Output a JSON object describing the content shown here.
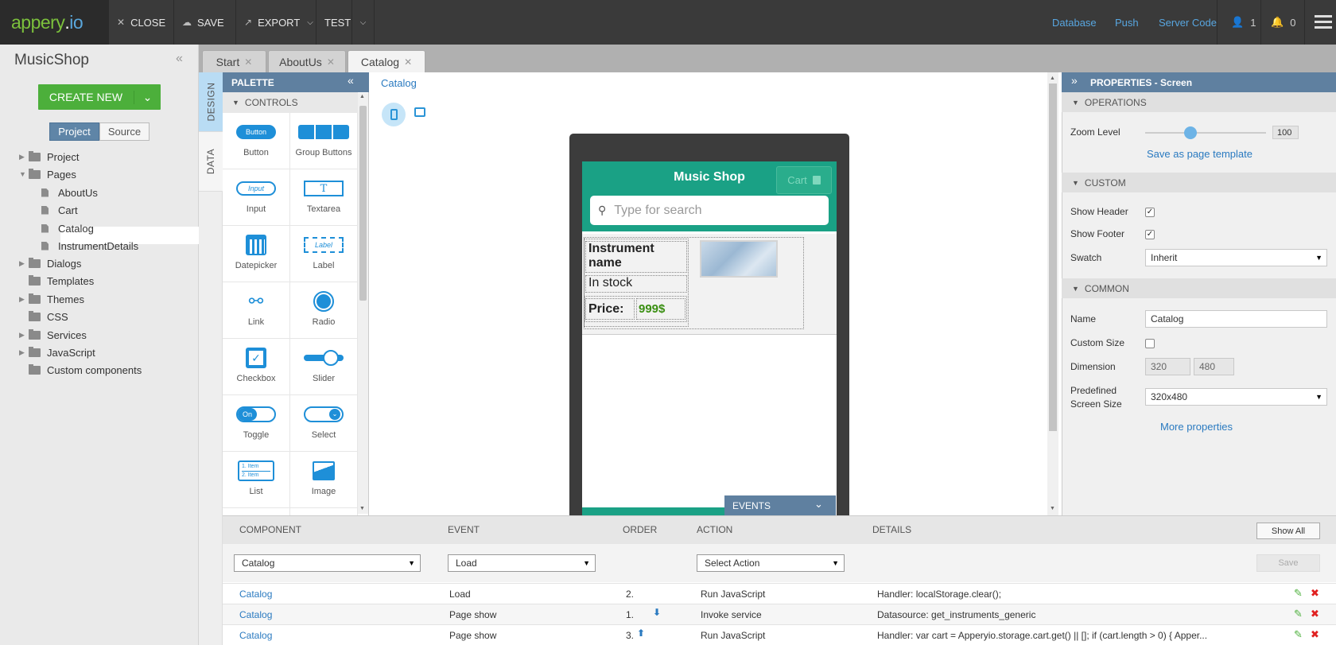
{
  "app": {
    "logo_part1": "appery",
    "logo_part2": ".",
    "logo_part3": "io",
    "toolbar": {
      "close": "CLOSE",
      "save": "SAVE",
      "export": "EXPORT",
      "test": "TEST"
    },
    "nav_links": [
      "Database",
      "Push",
      "Server Code"
    ],
    "user_count": "1",
    "notif_count": "0"
  },
  "project": {
    "name": "MusicShop",
    "create_new": "CREATE NEW",
    "tabs": {
      "project": "Project",
      "source": "Source"
    },
    "tree": [
      {
        "label": "Project",
        "kind": "folder"
      },
      {
        "label": "Pages",
        "kind": "folder"
      },
      {
        "label": "AboutUs",
        "kind": "page"
      },
      {
        "label": "Cart",
        "kind": "page"
      },
      {
        "label": "Catalog",
        "kind": "page"
      },
      {
        "label": "InstrumentDetails",
        "kind": "page"
      },
      {
        "label": "Dialogs",
        "kind": "folder"
      },
      {
        "label": "Templates",
        "kind": "folder"
      },
      {
        "label": "Themes",
        "kind": "folder"
      },
      {
        "label": "CSS",
        "kind": "folder"
      },
      {
        "label": "Services",
        "kind": "folder"
      },
      {
        "label": "JavaScript",
        "kind": "folder"
      },
      {
        "label": "Custom components",
        "kind": "folder"
      }
    ]
  },
  "page_tabs": [
    "Start",
    "AboutUs",
    "Catalog"
  ],
  "vtabs": {
    "design": "DESIGN",
    "data": "DATA"
  },
  "palette": {
    "title": "PALETTE",
    "section": "CONTROLS",
    "items": [
      "Button",
      "Group Buttons",
      "Input",
      "Textarea",
      "Datepicker",
      "Label",
      "Link",
      "Radio",
      "Checkbox",
      "Slider",
      "Toggle",
      "Select",
      "List",
      "Image"
    ],
    "icon_text": {
      "button": "Button",
      "input": "Input",
      "label": "Label",
      "toggle": "On",
      "list1": "1. Item",
      "list2": "2. Item",
      "textarea": "T"
    }
  },
  "canvas": {
    "breadcrumb": "Catalog",
    "phone": {
      "title": "Music Shop",
      "cart": "Cart",
      "search_placeholder": "Type for search",
      "instrument_name": "Instrument name",
      "in_stock": "In stock",
      "price_label": "Price:",
      "price_value": "999$"
    },
    "events_tab": "EVENTS"
  },
  "properties": {
    "title": "PROPERTIES - Screen",
    "operations": "OPERATIONS",
    "zoom_label": "Zoom Level",
    "zoom_value": "100",
    "save_template": "Save as page template",
    "custom": "CUSTOM",
    "show_header": "Show Header",
    "show_footer": "Show Footer",
    "swatch": "Swatch",
    "swatch_value": "Inherit",
    "common": "COMMON",
    "name_label": "Name",
    "name_value": "Catalog",
    "custom_size": "Custom Size",
    "dimension": "Dimension",
    "dim_w": "320",
    "dim_h": "480",
    "predefined_1": "Predefined",
    "predefined_2": "Screen Size",
    "predefined_value": "320x480",
    "more": "More properties"
  },
  "events": {
    "headers": [
      "COMPONENT",
      "EVENT",
      "ORDER",
      "ACTION",
      "DETAILS"
    ],
    "show_all": "Show All",
    "filter_component": "Catalog",
    "filter_event": "Load",
    "filter_action": "Select Action",
    "save": "Save",
    "rows": [
      {
        "component": "Catalog",
        "event": "Load",
        "order": "2.",
        "action": "Run JavaScript",
        "details": "Handler: localStorage.clear();"
      },
      {
        "component": "Catalog",
        "event": "Page show",
        "order": "1.",
        "action": "Invoke service",
        "details": "Datasource: get_instruments_generic"
      },
      {
        "component": "Catalog",
        "event": "Page show",
        "order": "3.",
        "action": "Run JavaScript",
        "details": "Handler: var cart = Apperyio.storage.cart.get() || []; if (cart.length > 0) { Apper..."
      }
    ]
  }
}
